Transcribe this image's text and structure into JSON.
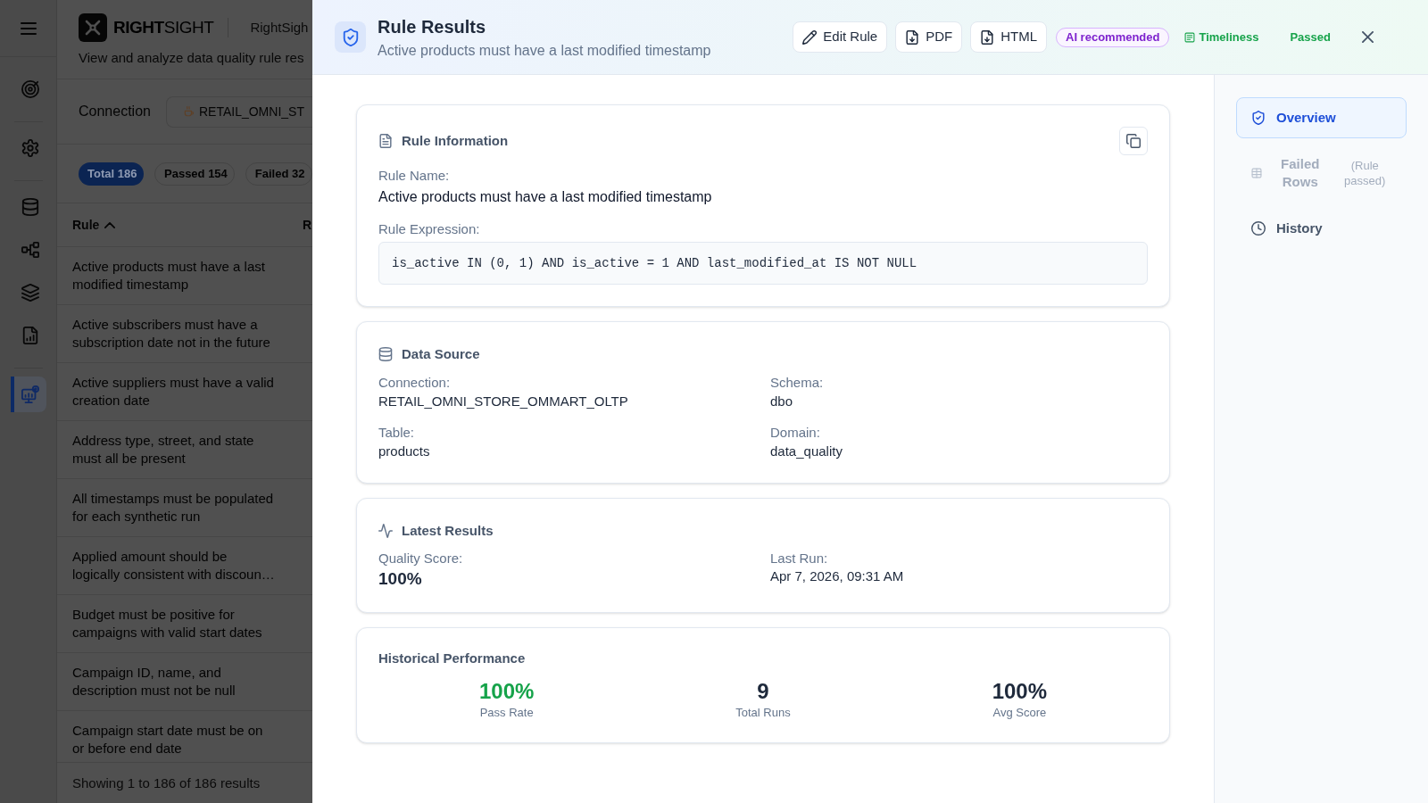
{
  "page": {
    "sidebar": {
      "items": [
        {
          "selected": false
        },
        {
          "selected": false
        },
        {
          "selected": false
        },
        {
          "selected": false
        },
        {
          "selected": false
        },
        {
          "selected": false
        },
        {
          "selected": true
        }
      ]
    },
    "header": {
      "logo": "**RIGHT**SIGHT",
      "app_name": "RightSigh",
      "subtitle": "View and analyze data quality rule res"
    },
    "connection": {
      "label": "Connection",
      "value": "RETAIL_OMNI_ST"
    },
    "filters": [
      {
        "label": "Total 186",
        "selected": true
      },
      {
        "label": "Passed 154",
        "selected": false
      },
      {
        "label": "Failed 32",
        "selected": false
      }
    ],
    "table": {
      "columns": [
        {
          "label": "Rule",
          "sorted": true
        },
        {
          "label": "R"
        }
      ],
      "rows": [
        {
          "rule": "Active products must have a last modified timestamp"
        },
        {
          "rule": "Active subscribers must have a subscription date not in the future"
        },
        {
          "rule": "Active suppliers must have a valid creation date"
        },
        {
          "rule": "Address type, street, and state must all be present"
        },
        {
          "rule": "All timestamps must be populated for each synthetic run"
        },
        {
          "rule": "Applied amount should be logically consistent with discoun…"
        },
        {
          "rule": "Budget must be positive for campaigns with valid start dates"
        },
        {
          "rule": "Campaign ID, name, and description must not be null"
        },
        {
          "rule": "Campaign start date must be on or before end date"
        }
      ]
    },
    "footer": "Showing 1 to 186 of 186 results"
  },
  "panel": {
    "title": "Rule Results",
    "subtitle": "Active products must have a last modified timestamp",
    "actions": [
      {
        "label": "Edit Rule",
        "kind": "edit"
      },
      {
        "label": "PDF",
        "kind": "download"
      },
      {
        "label": "HTML",
        "kind": "download"
      }
    ],
    "badges": [
      {
        "label": "AI recommended",
        "kind": "recommendation"
      },
      {
        "label": "Timeliness",
        "kind": "category"
      },
      {
        "label": "Passed",
        "kind": "status"
      }
    ],
    "rule_information": {
      "title": "Rule Information",
      "name_label": "Rule Name:",
      "name": "Active products must have a last modified timestamp",
      "expression_label": "Rule Expression:",
      "expression": "is_active IN (0, 1) AND is_active = 1 AND last_modified_at IS NOT NULL"
    },
    "data_source": {
      "title": "Data Source",
      "fields": [
        {
          "label": "Connection:",
          "value": "RETAIL_OMNI_STORE_OMMART_OLTP"
        },
        {
          "label": "Schema:",
          "value": "dbo"
        },
        {
          "label": "Table:",
          "value": "products"
        },
        {
          "label": "Domain:",
          "value": "data_quality"
        }
      ]
    },
    "latest_results": {
      "title": "Latest Results",
      "fields": [
        {
          "label": "Quality Score:",
          "value": "100%",
          "kind": "score"
        },
        {
          "label": "Last Run:",
          "value": "Apr 7, 2026, 09:31 AM",
          "kind": "text"
        }
      ]
    },
    "historical_performance": {
      "title": "Historical Performance",
      "stats": [
        {
          "value": "100%",
          "label": "Pass Rate",
          "color": "#16a34a"
        },
        {
          "value": "9",
          "label": "Total Runs",
          "color": "#1e293b"
        },
        {
          "value": "100%",
          "label": "Avg Score",
          "color": "#1e293b"
        }
      ]
    },
    "nav": [
      {
        "label": "Overview",
        "selected": true,
        "disabled": false
      },
      {
        "label": "Failed Rows",
        "note": "(Rule passed)",
        "selected": false,
        "disabled": true
      },
      {
        "label": "History",
        "selected": false,
        "disabled": false
      }
    ]
  }
}
